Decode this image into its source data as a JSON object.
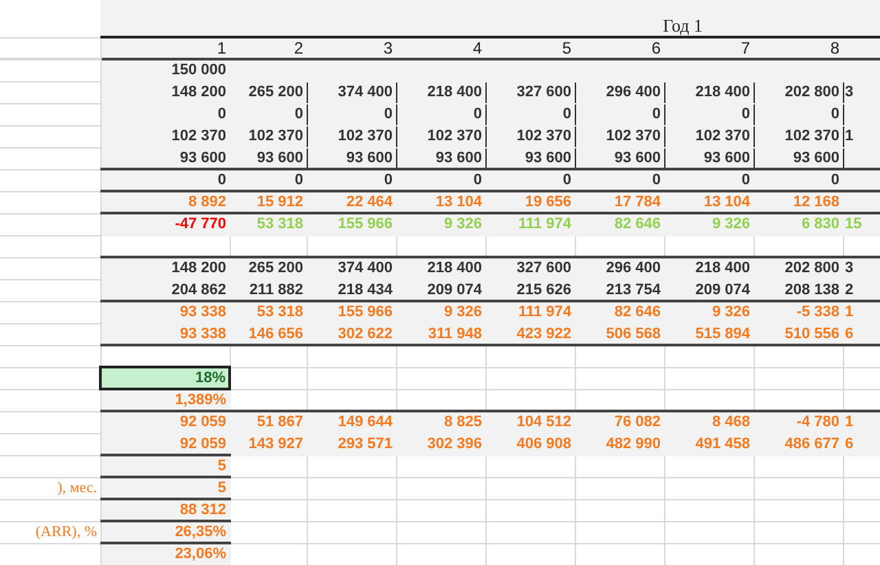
{
  "header": {
    "title": "Год 1",
    "columns": [
      "1",
      "2",
      "3",
      "4",
      "5",
      "6",
      "7",
      "8"
    ]
  },
  "rows": [
    {
      "kind": "band",
      "color": "#333333",
      "cells": [
        "150 000"
      ]
    },
    {
      "kind": "band",
      "ruled": true,
      "color": "#333333",
      "cells": [
        "148 200",
        "265 200",
        "374 400",
        "218 400",
        "327 600",
        "296 400",
        "218 400",
        "202 800",
        "3"
      ]
    },
    {
      "kind": "band",
      "ruled": true,
      "color": "#333333",
      "cells": [
        "0",
        "0",
        "0",
        "0",
        "0",
        "0",
        "0",
        "0"
      ]
    },
    {
      "kind": "band",
      "ruled": true,
      "color": "#333333",
      "cells": [
        "102 370",
        "102 370",
        "102 370",
        "102 370",
        "102 370",
        "102 370",
        "102 370",
        "102 370",
        "1"
      ]
    },
    {
      "kind": "band",
      "ruled": true,
      "color": "#333333",
      "cells": [
        "93 600",
        "93 600",
        "93 600",
        "93 600",
        "93 600",
        "93 600",
        "93 600",
        "93 600"
      ]
    },
    {
      "kind": "band",
      "section_start": true,
      "color": "#333333",
      "cells": [
        "0",
        "0",
        "0",
        "0",
        "0",
        "0",
        "0",
        "0"
      ]
    },
    {
      "kind": "band",
      "section_start": true,
      "color": "#f47a20",
      "cells": [
        "8 892",
        "15 912",
        "22 464",
        "13 104",
        "19 656",
        "17 784",
        "13 104",
        "12 168"
      ]
    },
    {
      "kind": "band",
      "section_start": true,
      "color": "#92d050",
      "cells": [
        {
          "text": "-47 770",
          "color": "#ff0000"
        },
        "53 318",
        "155 966",
        "9 326",
        "111 974",
        "82 646",
        "9 326",
        "6 830",
        "15"
      ]
    },
    {
      "kind": "plain",
      "cells": []
    },
    {
      "kind": "band",
      "section_start": true,
      "color": "#333333",
      "cells": [
        "148 200",
        "265 200",
        "374 400",
        "218 400",
        "327 600",
        "296 400",
        "218 400",
        "202 800",
        "3"
      ]
    },
    {
      "kind": "band",
      "color": "#333333",
      "cells": [
        "204 862",
        "211 882",
        "218 434",
        "209 074",
        "215 626",
        "213 754",
        "209 074",
        "208 138",
        "2"
      ]
    },
    {
      "kind": "band",
      "section_start": true,
      "color": "#f47a20",
      "cells": [
        "93 338",
        "53 318",
        "155 966",
        "9 326",
        "111 974",
        "82 646",
        "9 326",
        "-5 338",
        "1"
      ]
    },
    {
      "kind": "band",
      "color": "#f47a20",
      "cells": [
        "93 338",
        "146 656",
        "302 622",
        "311 948",
        "423 922",
        "506 568",
        "515 894",
        "510 556",
        "6"
      ]
    },
    {
      "kind": "plain",
      "section_start": true,
      "cells": []
    },
    {
      "kind": "plain",
      "color": "#1e6b2e",
      "cells": [
        {
          "text": "18%",
          "highlighted": true
        }
      ]
    },
    {
      "kind": "lead",
      "color": "#f47a20",
      "cells": [
        "1,389%"
      ]
    },
    {
      "kind": "band",
      "section_start": true,
      "color": "#f47a20",
      "cells": [
        "92 059",
        "51 867",
        "149 644",
        "8 825",
        "104 512",
        "76 082",
        "8 468",
        "-4 780",
        "1"
      ]
    },
    {
      "kind": "band",
      "color": "#f47a20",
      "cells": [
        "92 059",
        "143 927",
        "293 571",
        "302 396",
        "406 908",
        "482 990",
        "491 458",
        "486 677",
        "6"
      ]
    },
    {
      "kind": "lead",
      "section_start": true,
      "color": "#f47a20",
      "cells": [
        "5"
      ]
    },
    {
      "kind": "lead",
      "section_start": true,
      "label": "), мес.",
      "color": "#f47a20",
      "cells": [
        "5"
      ]
    },
    {
      "kind": "lead",
      "section_start": true,
      "color": "#f47a20",
      "cells": [
        "88 312"
      ]
    },
    {
      "kind": "lead",
      "section_start": true,
      "label": "(ARR), %",
      "color": "#f47a20",
      "cells": [
        "26,35%"
      ]
    },
    {
      "kind": "lead",
      "section_start": true,
      "color": "#f47a20",
      "cells": [
        "23,06%"
      ]
    }
  ]
}
